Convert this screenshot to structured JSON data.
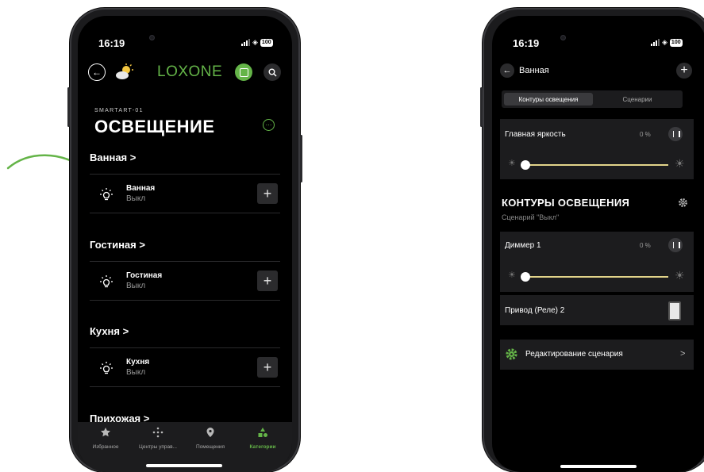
{
  "colors": {
    "accent": "#64b448",
    "background": "#000000",
    "card": "#1c1c1e",
    "slider_fill": "#e2d48a"
  },
  "left_phone": {
    "status": {
      "time": "16:19",
      "battery": "100"
    },
    "header": {
      "back_icon": "arrow-left-icon",
      "weather_icon": "sun-cloud-icon",
      "logo": "LOXONE",
      "search_icon": "search-icon"
    },
    "subtitle": "SMARTART-01",
    "title": "ОСВЕЩЕНИЕ",
    "rooms": [
      {
        "heading": "Ванная >",
        "item": "Ванная",
        "state": "Выкл"
      },
      {
        "heading": "Гостиная >",
        "item": "Гостиная",
        "state": "Выкл"
      },
      {
        "heading": "Кухня >",
        "item": "Кухня",
        "state": "Выкл"
      },
      {
        "heading": "Прихожая >"
      }
    ],
    "plus_label": "+",
    "tabs": [
      {
        "label": "Избранное",
        "icon": "star-icon"
      },
      {
        "label": "Центры управ...",
        "icon": "dots-icon"
      },
      {
        "label": "Помещения",
        "icon": "location-pin-icon"
      },
      {
        "label": "Категории",
        "icon": "categories-icon",
        "active": true
      }
    ]
  },
  "right_phone": {
    "status": {
      "time": "16:19",
      "battery": "100"
    },
    "header": {
      "title": "Ванная",
      "plus_label": "+"
    },
    "segments": {
      "active": "Контуры освещения",
      "inactive": "Сценарии"
    },
    "master": {
      "label": "Главная яркость",
      "value": "0 %",
      "level": 0
    },
    "section": {
      "title": "КОНТУРЫ ОСВЕЩЕНИЯ",
      "subtitle": "Сценарий \"Выкл\""
    },
    "dimmer": {
      "label": "Диммер 1",
      "value": "0 %",
      "level": 0
    },
    "relay": {
      "label": "Привод (Реле) 2"
    },
    "edit": {
      "label": "Редактирование сценария",
      "chevron": ">"
    }
  }
}
